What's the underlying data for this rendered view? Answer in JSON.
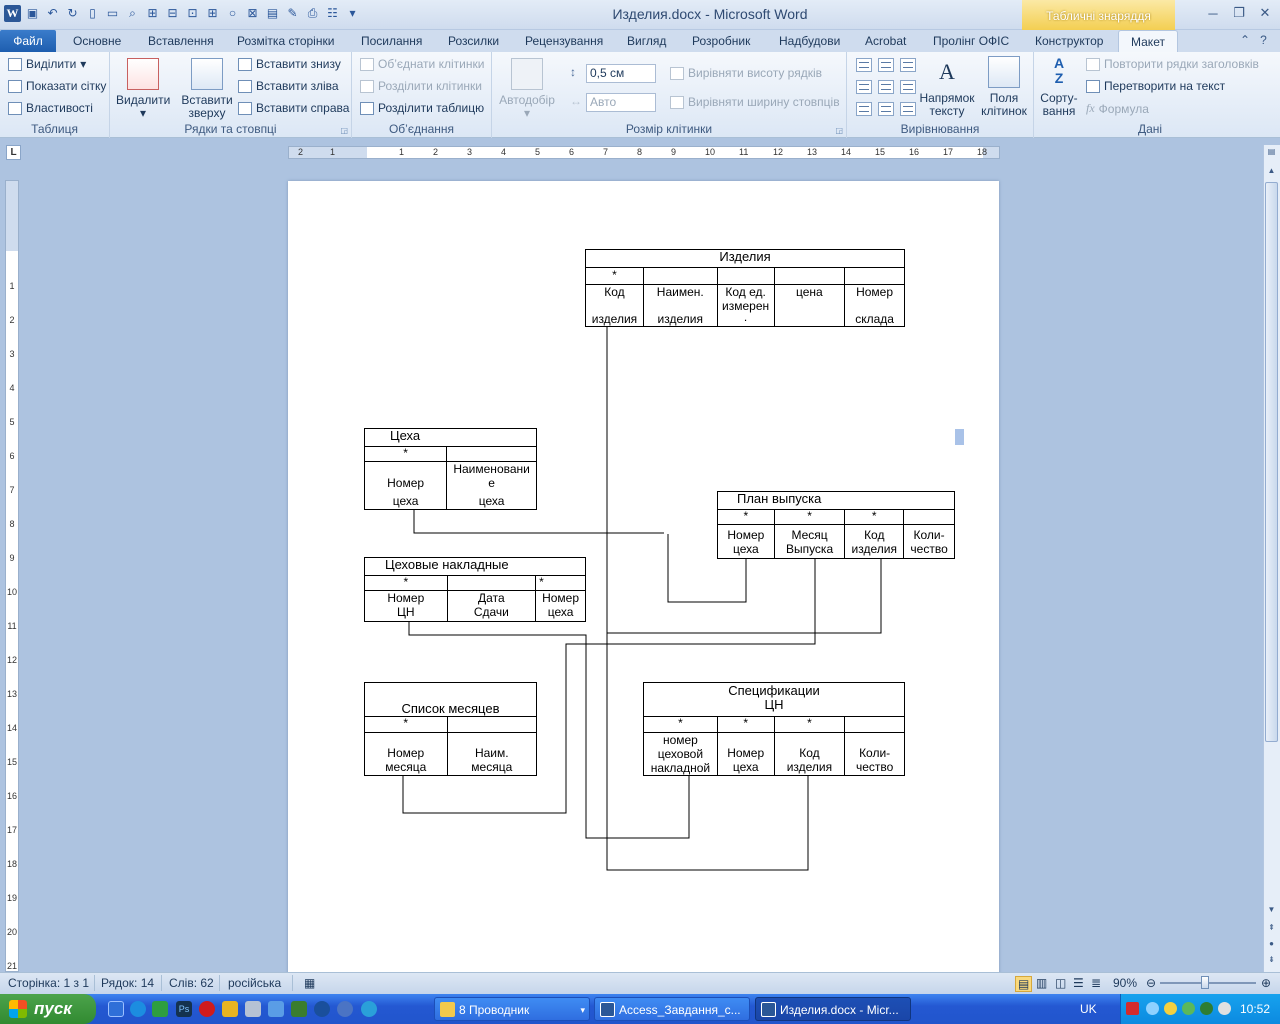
{
  "window": {
    "title": "Изделия.docx - Microsoft Word",
    "table_tools_label": "Табличні знаряддя"
  },
  "tabs": [
    "Файл",
    "Основне",
    "Вставлення",
    "Розмітка сторінки",
    "Посилання",
    "Розсилки",
    "Рецензування",
    "Вигляд",
    "Розробник",
    "Надбудови",
    "Acrobat",
    "Пролінг ОФІС",
    "Конструктор",
    "Макет"
  ],
  "ribbon": {
    "table_group": {
      "label": "Таблиця",
      "select": "Виділити",
      "show_grid": "Показати сітку",
      "properties": "Властивості"
    },
    "rows_cols_group": {
      "label": "Рядки та стовпці",
      "delete": "Видалити",
      "insert_above": "Вставити зверху",
      "insert_below": "Вставити знизу",
      "insert_left": "Вставити зліва",
      "insert_right": "Вставити справа"
    },
    "merge_group": {
      "label": "Об’єднання",
      "merge_cells": "Об’єднати клітинки",
      "split_cells": "Розділити клітинки",
      "split_table": "Розділити таблицю"
    },
    "cell_size_group": {
      "label": "Розмір клітинки",
      "autofit": "Автодобір",
      "height_value": "0,5 см",
      "width_value": "Авто",
      "distribute_rows": "Вирівняти висоту рядків",
      "distribute_cols": "Вирівняти ширину стовпців"
    },
    "alignment_group": {
      "label": "Вирівнювання",
      "text_direction": "Напрямок тексту",
      "cell_margins": "Поля клітинок"
    },
    "data_group": {
      "label": "Дані",
      "sort": "Сорту-вання",
      "repeat_header": "Повторити рядки заголовків",
      "convert": "Перетворити на текст",
      "formula": "Формула"
    }
  },
  "ruler": {
    "tab_selector": "L",
    "h_ticks": [
      "2",
      "1",
      "1",
      "2",
      "3",
      "4",
      "5",
      "6",
      "7",
      "8",
      "9",
      "10",
      "11",
      "12",
      "13",
      "14",
      "15",
      "16",
      "17",
      "18"
    ],
    "v_ticks": [
      "1",
      "2",
      "3",
      "4",
      "5",
      "6",
      "7",
      "8",
      "9",
      "10",
      "11",
      "12",
      "13",
      "14",
      "15",
      "16",
      "17",
      "18",
      "19",
      "20",
      "21"
    ]
  },
  "diagram": {
    "izdeliya": {
      "title": "Изделия",
      "keys": [
        "*",
        "",
        "",
        "",
        ""
      ],
      "fields": [
        [
          "Код",
          "изделия"
        ],
        [
          "Наимен.",
          "изделия"
        ],
        [
          "Код ед.",
          "измерен",
          "."
        ],
        [
          "цена"
        ],
        [
          "Номер",
          "склада"
        ]
      ]
    },
    "tsekha": {
      "title": "Цеха",
      "keys": [
        "*",
        ""
      ],
      "fields": [
        [
          "Номер",
          "цеха"
        ],
        [
          "Наименовани",
          "е",
          "цеха"
        ]
      ]
    },
    "plan": {
      "title": "План  выпуска",
      "keys": [
        "*",
        "*",
        "*",
        ""
      ],
      "fields": [
        [
          "Номер",
          "цеха"
        ],
        [
          "Месяц",
          "Выпуска"
        ],
        [
          "Код",
          "изделия"
        ],
        [
          "Коли-",
          "чество"
        ]
      ]
    },
    "nakladnye": {
      "title": "Цеховые  накладные",
      "keys": [
        "*",
        "",
        "*"
      ],
      "fields": [
        [
          "Номер",
          "ЦН"
        ],
        [
          "Дата",
          "Сдачи"
        ],
        [
          "Номер",
          "цеха"
        ]
      ]
    },
    "mesyatsy": {
      "title": "Список месяцев",
      "keys": [
        "*",
        ""
      ],
      "fields": [
        [
          "Номер",
          "месяца"
        ],
        [
          "Наим.",
          "месяца"
        ]
      ]
    },
    "spec": {
      "title": [
        "Спецификации",
        "ЦН"
      ],
      "keys": [
        "*",
        "*",
        "*",
        ""
      ],
      "fields": [
        [
          "номер",
          "цеховой",
          "накладной"
        ],
        [
          "Номер",
          "цеха"
        ],
        [
          "Код",
          "изделия"
        ],
        [
          "Коли-",
          "чество"
        ]
      ]
    }
  },
  "status": {
    "page": "Сторінка: 1 з 1",
    "line": "Рядок: 14",
    "words": "Слів: 62",
    "language": "російська",
    "zoom": "90%"
  },
  "taskbar": {
    "start": "пуск",
    "buttons": [
      "8 Проводник",
      "Access_Завдання_с...",
      "Изделия.docx - Micr..."
    ],
    "lang": "UK",
    "clock": "10:52"
  }
}
